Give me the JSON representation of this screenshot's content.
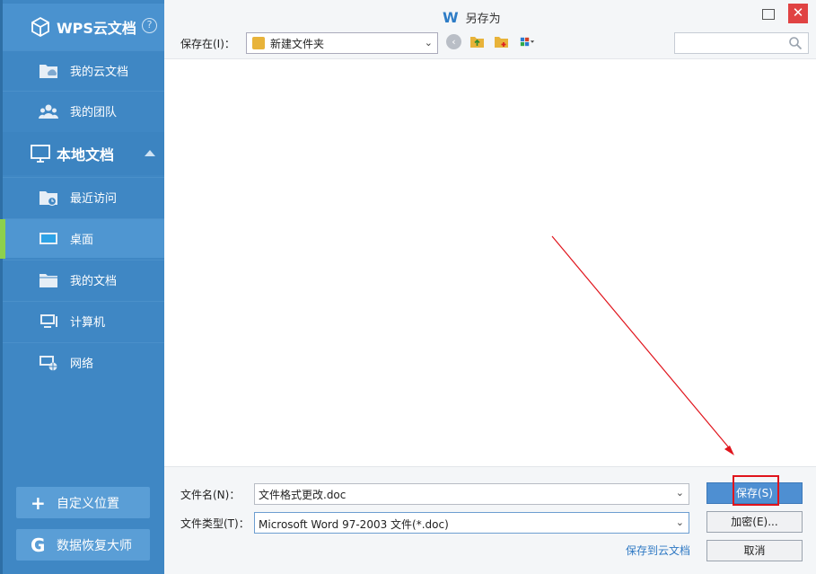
{
  "sidebar": {
    "cloud_header": {
      "title": "WPS云文档",
      "help": "?"
    },
    "cloud_items": [
      {
        "label": "我的云文档",
        "icon": "cloud-folder-icon"
      },
      {
        "label": "我的团队",
        "icon": "team-icon"
      }
    ],
    "local_header": {
      "title": "本地文档"
    },
    "local_items": [
      {
        "label": "最近访问",
        "icon": "recent-folder-icon"
      },
      {
        "label": "桌面",
        "icon": "desktop-icon",
        "active": true
      },
      {
        "label": "我的文档",
        "icon": "documents-folder-icon"
      },
      {
        "label": "计算机",
        "icon": "computer-icon"
      },
      {
        "label": "网络",
        "icon": "network-icon"
      }
    ],
    "buttons": {
      "custom_location": {
        "label": "自定义位置",
        "icon": "+"
      },
      "data_recovery": {
        "label": "数据恢复大师",
        "icon": "G"
      }
    }
  },
  "dialog": {
    "title_icon": "W",
    "title": "另存为",
    "window_controls": {
      "close": "✕"
    },
    "toolbar": {
      "save_in_label": "保存在(I)：",
      "current_folder": "新建文件夹",
      "back": "‹",
      "search_placeholder": ""
    },
    "form": {
      "filename_label": "文件名(N)：",
      "filename_value": "文件格式更改.doc",
      "filetype_label": "文件类型(T)：",
      "filetype_value": "Microsoft Word 97-2003 文件(*.doc)"
    },
    "buttons": {
      "save": "保存(S)",
      "encrypt": "加密(E)...",
      "cancel": "取消"
    },
    "save_to_cloud_link": "保存到云文档"
  },
  "colors": {
    "sidebar_bg": "#3f87c4",
    "active_indicator": "#8dd04c",
    "save_button": "#4e8fd2",
    "close_button": "#e04343",
    "annotation_red": "#e0141c"
  }
}
